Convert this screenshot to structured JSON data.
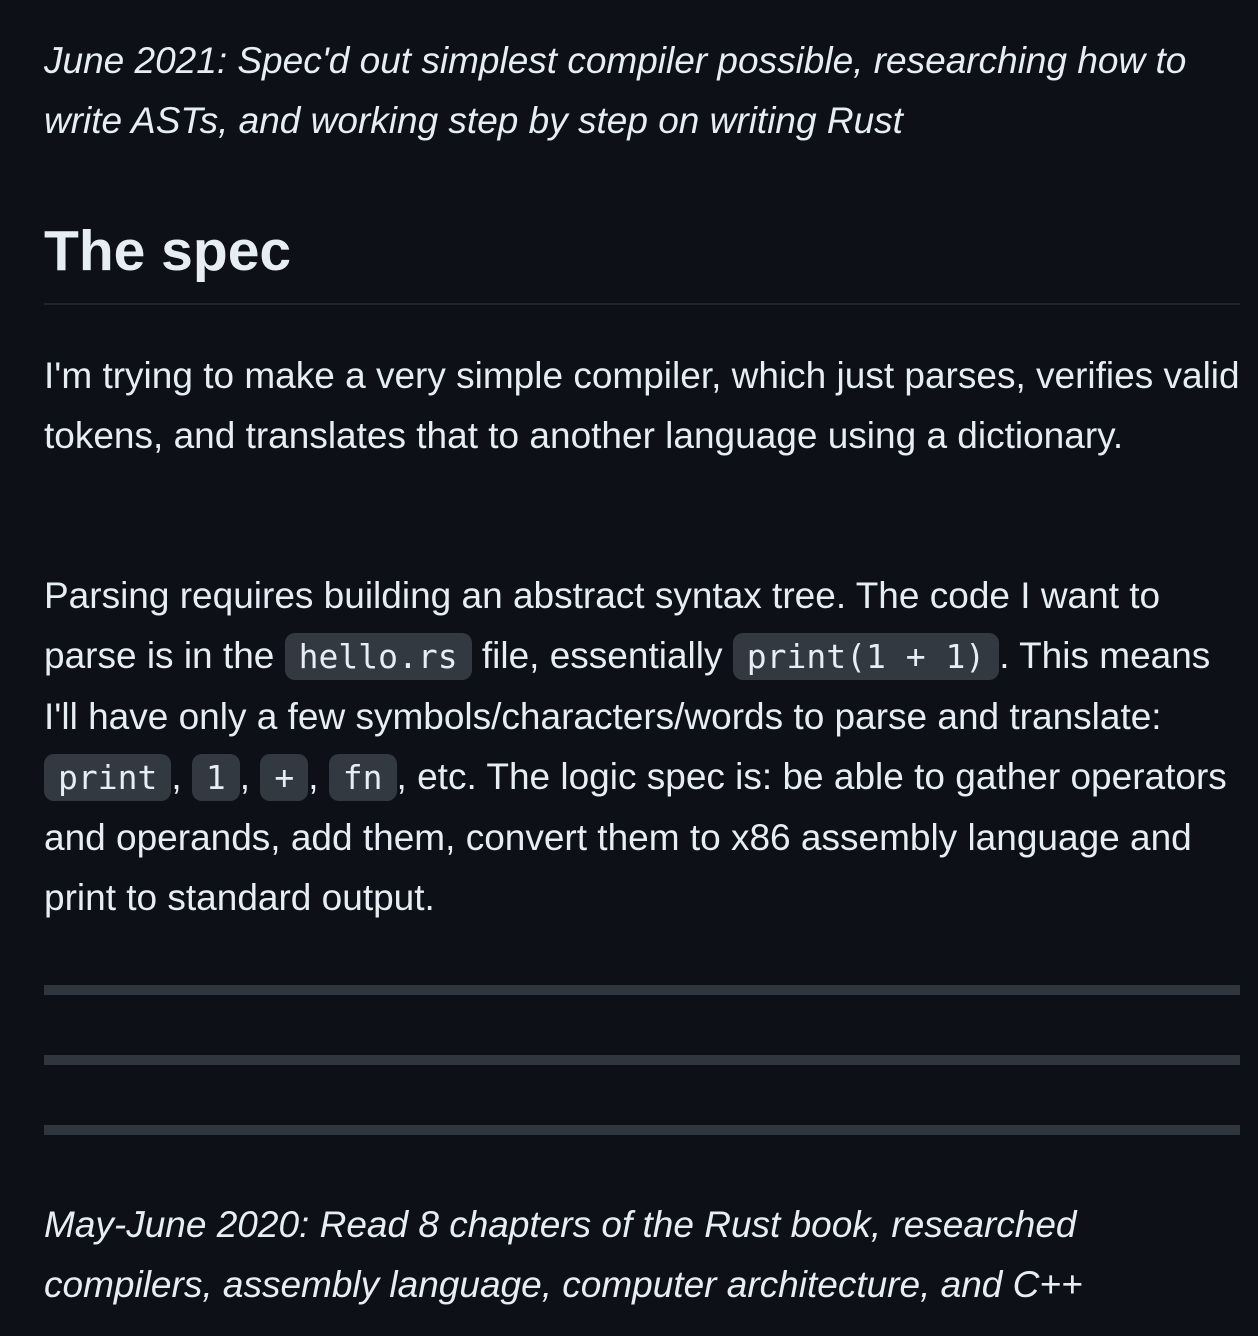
{
  "notes": {
    "top": "June 2021: Spec'd out simplest compiler possible, researching how to write ASTs, and working step by step on writing Rust",
    "bottom": "May-June 2020: Read 8 chapters of the Rust book, researched compilers, assembly language, computer architecture, and C++"
  },
  "heading": "The spec",
  "para1": "I'm trying to make a very simple compiler, which just parses, verifies valid tokens, and translates that to another language using a dictionary.",
  "para2": {
    "t1": "Parsing requires building an abstract syntax tree. The code I want to parse is in the ",
    "code1": "hello.rs",
    "t2": " file, essentially ",
    "code2": "print(1 + 1)",
    "t3": ". This means I'll have only a few symbols/characters/words to parse and translate: ",
    "code3": "print",
    "sep1": ", ",
    "code4": "1",
    "sep2": ", ",
    "code5": "+",
    "sep3": ", ",
    "code6": "fn",
    "t4": ", etc. The logic spec is: be able to gather operators and operands, add them, convert them to x86 assembly language and print to standard output."
  }
}
